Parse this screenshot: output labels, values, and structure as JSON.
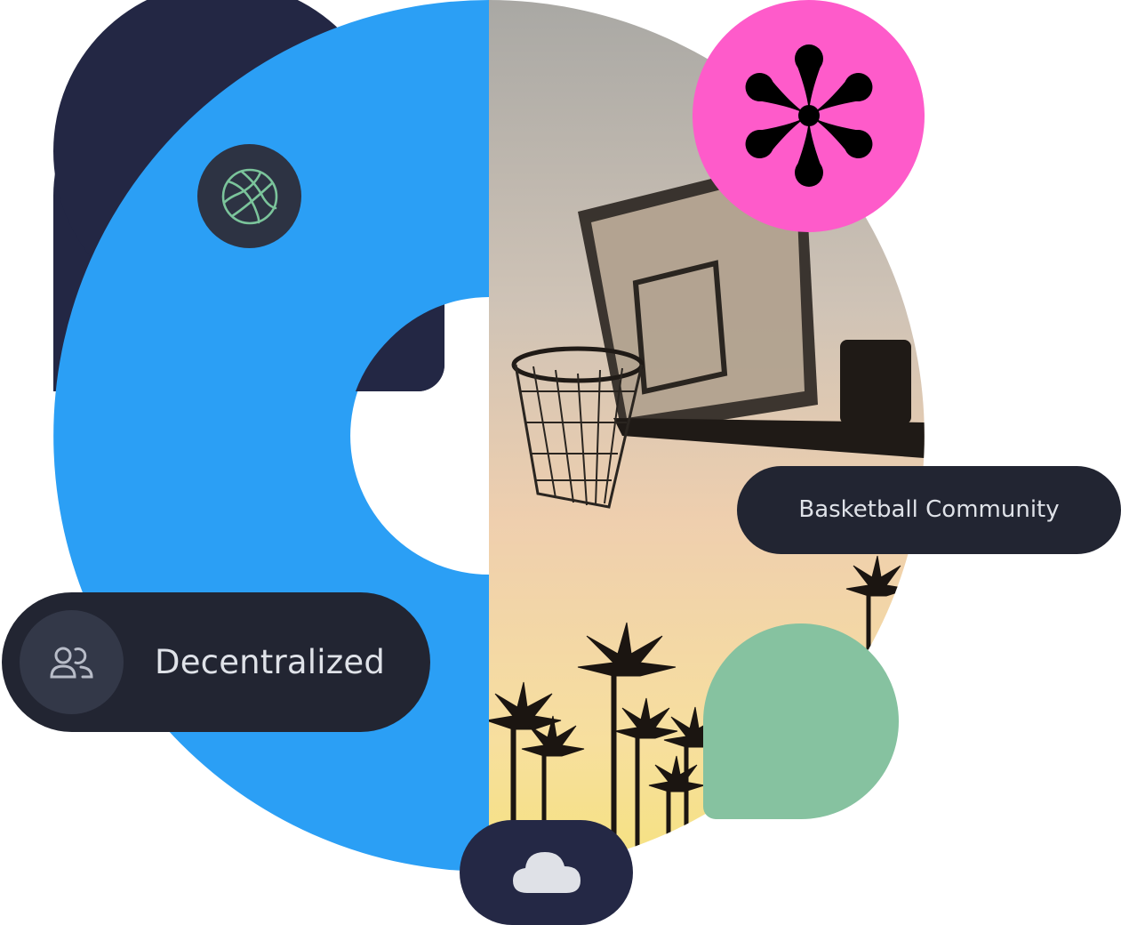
{
  "badges": {
    "decentralized_label": "Decentralized",
    "community_label": "Basketball Community"
  },
  "icons": {
    "basketball": "basketball-icon",
    "asterisk": "asterisk-icon",
    "users": "users-icon",
    "cloud": "cloud-icon"
  },
  "colors": {
    "navy": "#232744",
    "blue": "#2b9ff5",
    "pink": "#fe5bca",
    "green": "#86c2a0",
    "pill": "#222532"
  }
}
